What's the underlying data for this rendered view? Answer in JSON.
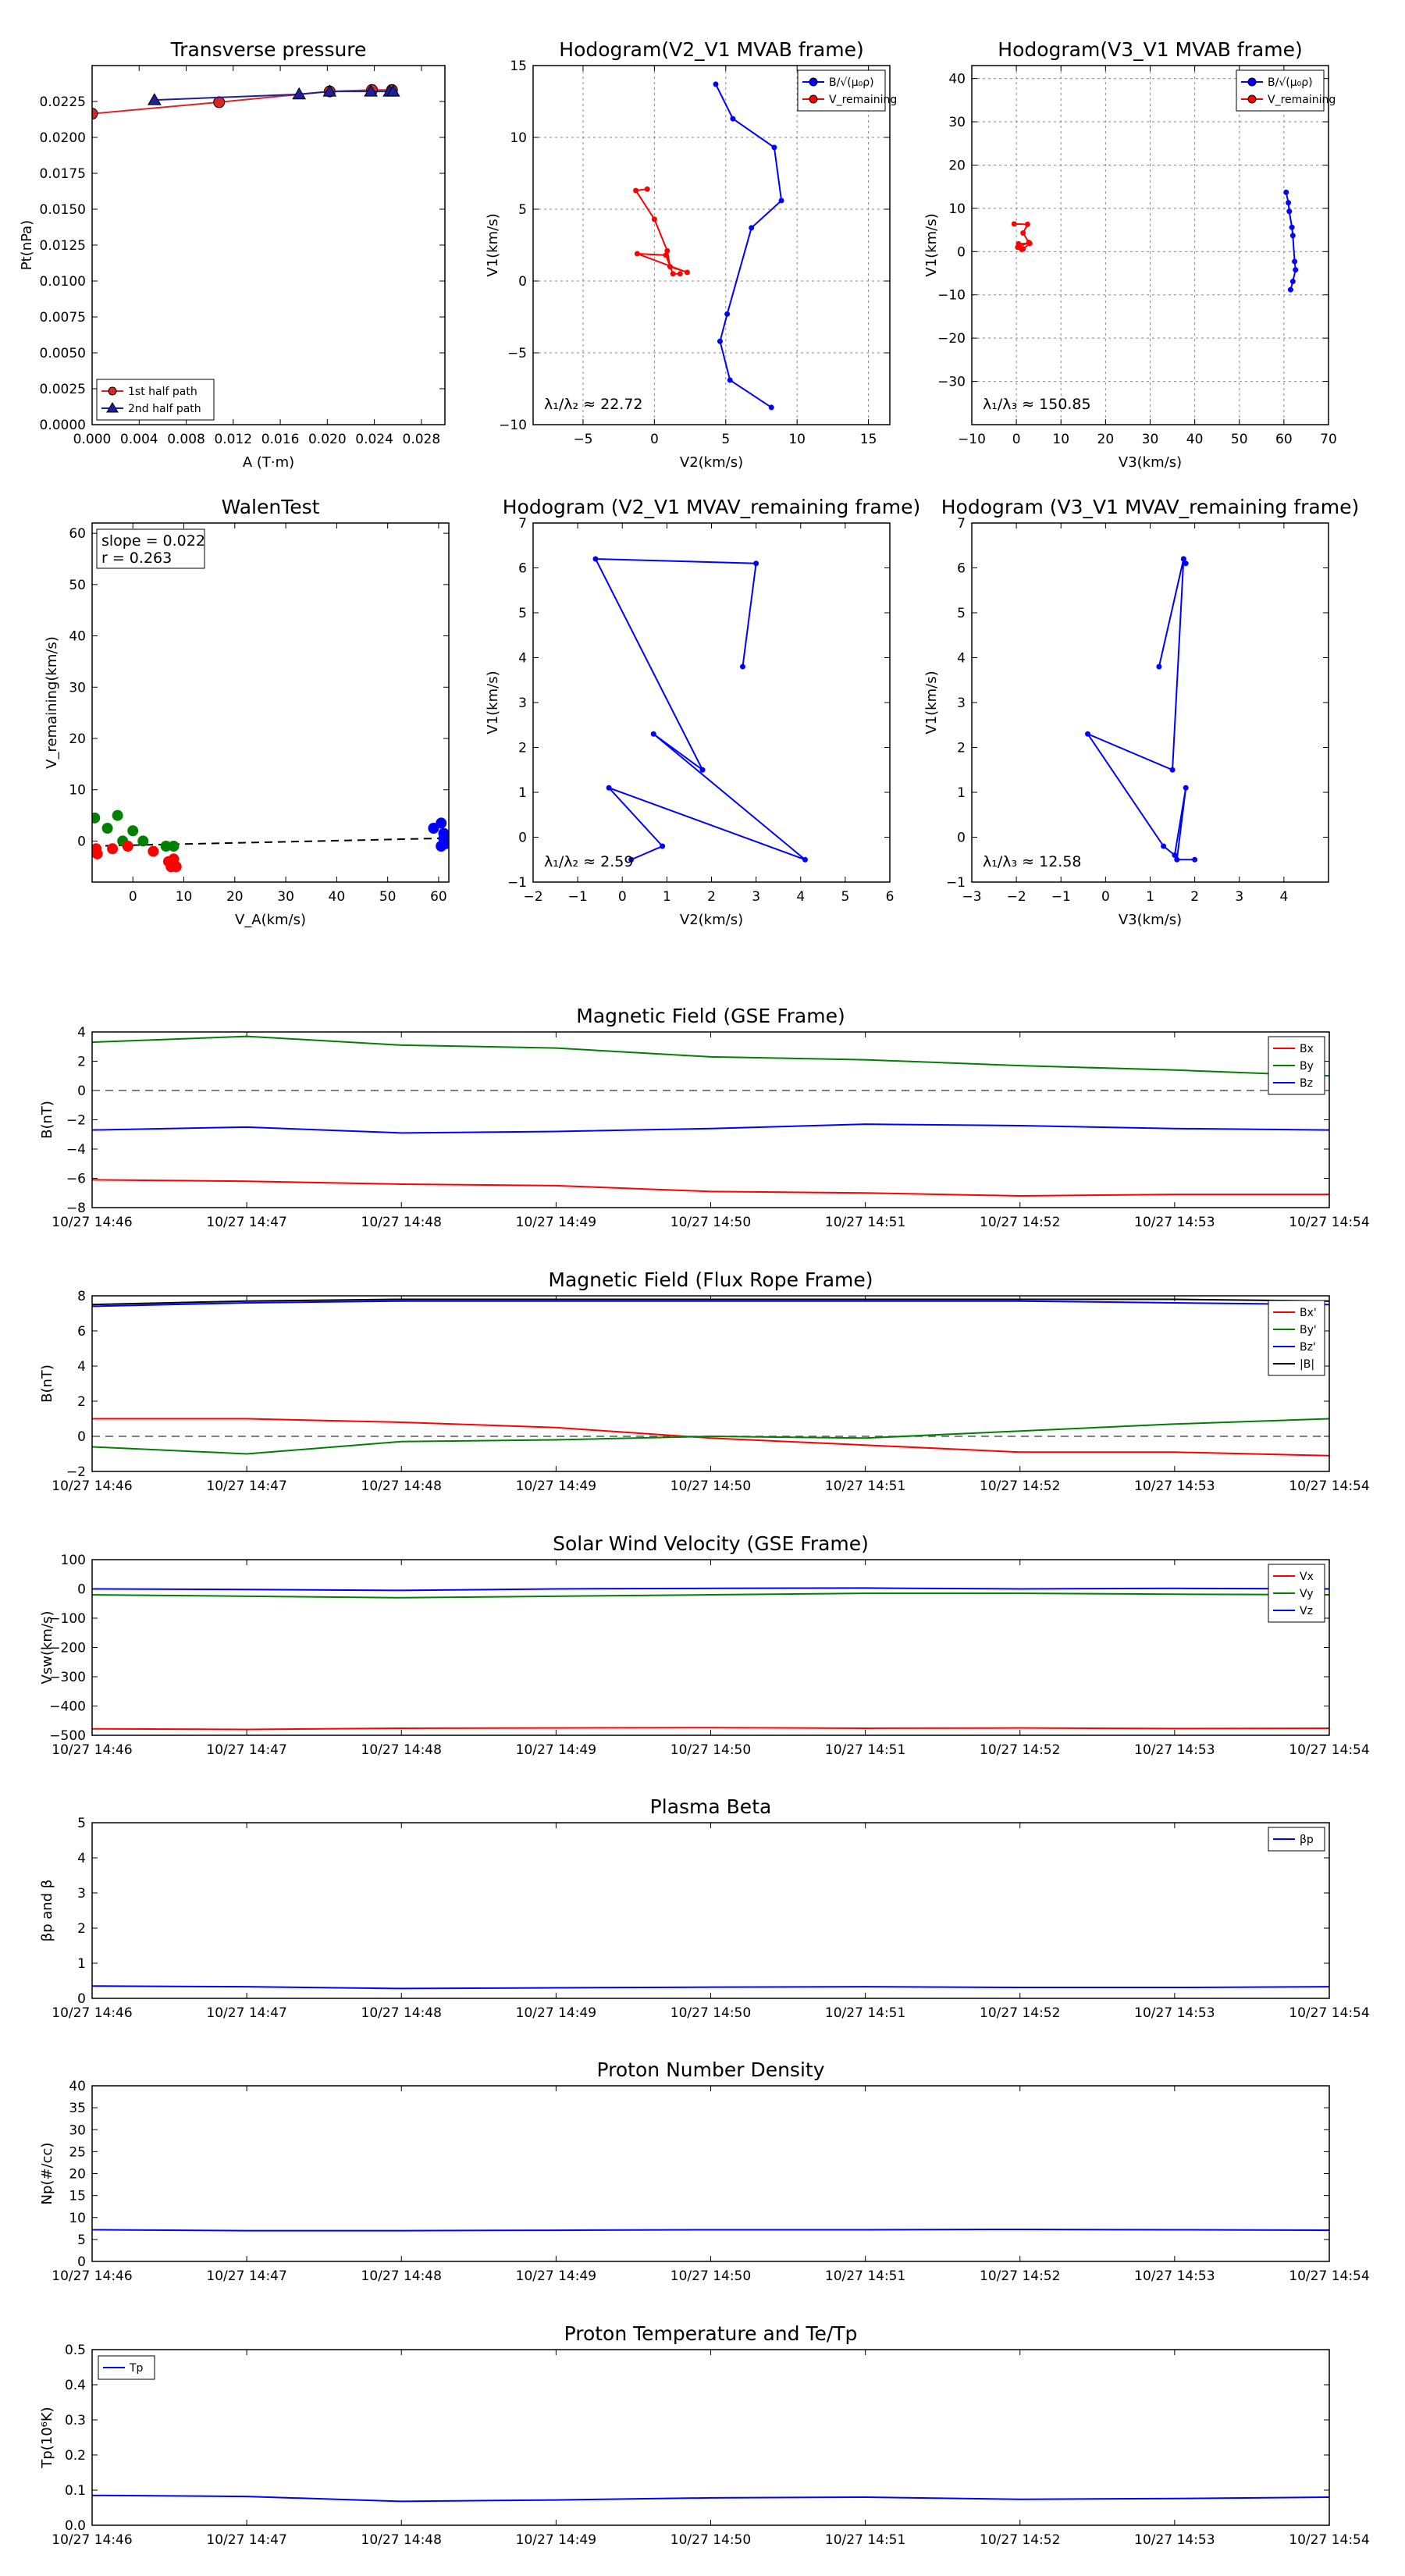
{
  "panels": [
    {
      "id": "transverse-pressure",
      "type": "scatter-line",
      "title": "Transverse pressure",
      "xlabel": "A (T·m)",
      "ylabel": "Pt(nPa)",
      "xlim": [
        0,
        0.03
      ],
      "ylim": [
        0,
        0.025
      ],
      "xticks": [
        0,
        0.004,
        0.008,
        0.012,
        0.016,
        0.02,
        0.024,
        0.028
      ],
      "xticklabels": [
        "0.000",
        "0.004",
        "0.008",
        "0.012",
        "0.016",
        "0.020",
        "0.024",
        "0.028"
      ],
      "yticks": [
        0,
        0.0025,
        0.005,
        0.0075,
        0.01,
        0.0125,
        0.015,
        0.0175,
        0.02,
        0.0225
      ],
      "yticklabels": [
        "0.0000",
        "0.0025",
        "0.0050",
        "0.0075",
        "0.0100",
        "0.0125",
        "0.0150",
        "0.0175",
        "0.0200",
        "0.0225"
      ],
      "grid": false,
      "legend": "lower-left",
      "series": [
        {
          "name": "1st half path",
          "color": "#d62728",
          "marker": "circle",
          "x": [
            0.0,
            0.0108,
            0.0202,
            0.0238,
            0.0255
          ],
          "y": [
            0.02165,
            0.02245,
            0.0232,
            0.0233,
            0.0233
          ]
        },
        {
          "name": "2nd half path",
          "color": "#1f1f9a",
          "marker": "triangle",
          "x": [
            0.0053,
            0.0176,
            0.0202,
            0.0237,
            0.0253,
            0.0256
          ],
          "y": [
            0.0226,
            0.023,
            0.0232,
            0.0232,
            0.0232,
            0.0232
          ]
        }
      ]
    },
    {
      "id": "hodogram-v2-v1-mvab",
      "type": "line",
      "title": "Hodogram(V2_V1 MVAB frame)",
      "xlabel": "V2(km/s)",
      "ylabel": "V1(km/s)",
      "xlim": [
        -8.5,
        16.5
      ],
      "ylim": [
        -10,
        15
      ],
      "xticks": [
        -5,
        0,
        5,
        10,
        15
      ],
      "xticklabels": [
        "−5",
        "0",
        "5",
        "10",
        "15"
      ],
      "yticks": [
        -10,
        -5,
        0,
        5,
        10,
        15
      ],
      "yticklabels": [
        "−10",
        "−5",
        "0",
        "5",
        "10",
        "15"
      ],
      "grid": true,
      "legend": "top-right",
      "note": "λ₁/λ₂ ≈ 22.72",
      "series": [
        {
          "name": "B/√(μ₀ρ)",
          "color": "#0000ff",
          "x": [
            4.3,
            5.5,
            8.4,
            8.9,
            6.8,
            5.1,
            4.6,
            5.3,
            8.2
          ],
          "y": [
            13.7,
            11.3,
            9.3,
            5.6,
            3.7,
            -2.3,
            -4.2,
            -6.9,
            -8.8
          ]
        },
        {
          "name": "V_remaining",
          "color": "#ff0000",
          "x": [
            -0.5,
            -1.3,
            0.0,
            0.9,
            1.1,
            2.3,
            -1.2,
            0.8,
            1.3,
            1.8
          ],
          "y": [
            6.4,
            6.3,
            4.3,
            2.1,
            1.0,
            0.6,
            1.9,
            1.8,
            0.5,
            0.5
          ]
        }
      ]
    },
    {
      "id": "hodogram-v3-v1-mvab",
      "type": "line",
      "title": "Hodogram(V3_V1 MVAB frame)",
      "xlabel": "V3(km/s)",
      "ylabel": "V1(km/s)",
      "xlim": [
        -10,
        70
      ],
      "ylim": [
        -40,
        43
      ],
      "xticks": [
        -10,
        0,
        10,
        20,
        30,
        40,
        50,
        60,
        70
      ],
      "xticklabels": [
        "−10",
        "0",
        "10",
        "20",
        "30",
        "40",
        "50",
        "60",
        "70"
      ],
      "yticks": [
        -30,
        -20,
        -10,
        0,
        10,
        20,
        30,
        40
      ],
      "yticklabels": [
        "−30",
        "−20",
        "−10",
        "0",
        "10",
        "20",
        "30",
        "40"
      ],
      "grid": true,
      "legend": "top-right",
      "note": "λ₁/λ₃ ≈ 150.85",
      "series": [
        {
          "name": "B/√(μ₀ρ)",
          "color": "#0000ff",
          "x": [
            60.5,
            61.0,
            61.2,
            61.8,
            62.0,
            62.4,
            62.6,
            62.0,
            61.5
          ],
          "y": [
            13.7,
            11.3,
            9.3,
            5.6,
            3.7,
            -2.3,
            -4.2,
            -6.9,
            -8.8
          ]
        },
        {
          "name": "V_remaining",
          "color": "#ff0000",
          "x": [
            -0.5,
            2.5,
            1.5,
            2.8,
            0.3,
            1.5,
            3.0,
            0.5,
            1.2
          ],
          "y": [
            6.4,
            6.3,
            4.3,
            2.1,
            1.0,
            0.6,
            1.9,
            1.8,
            0.5
          ]
        }
      ]
    },
    {
      "id": "walen-test",
      "type": "scatter",
      "title": "WalenTest",
      "xlabel": "V_A(km/s)",
      "ylabel": "V_remaining(km/s)",
      "xlim": [
        -8,
        62
      ],
      "ylim": [
        -8,
        62
      ],
      "xticks": [
        0,
        10,
        20,
        30,
        40,
        50,
        60
      ],
      "xticklabels": [
        "0",
        "10",
        "20",
        "30",
        "40",
        "50",
        "60"
      ],
      "yticks": [
        0,
        10,
        20,
        30,
        40,
        50,
        60
      ],
      "yticklabels": [
        "0",
        "10",
        "20",
        "30",
        "40",
        "50",
        "60"
      ],
      "grid": false,
      "stats": {
        "slope": "slope = 0.022",
        "r": "r = 0.263"
      },
      "fit": {
        "slope": 0.022,
        "intercept": -0.8
      },
      "series": [
        {
          "name": "blue",
          "color": "#0000ff",
          "x": [
            59,
            60.5,
            61,
            61.5,
            60.5,
            61
          ],
          "y": [
            2.5,
            3.5,
            1.5,
            -0.5,
            -1.0,
            0.5
          ]
        },
        {
          "name": "green",
          "color": "#008000",
          "x": [
            -7.5,
            -5,
            -3,
            -2,
            0,
            2,
            6.5,
            8
          ],
          "y": [
            4.5,
            2.5,
            5,
            0,
            2,
            0,
            -1,
            -1
          ]
        },
        {
          "name": "red",
          "color": "#ff0000",
          "x": [
            -7.2,
            -7,
            -4,
            -1,
            4,
            7,
            7.5,
            8,
            8.5
          ],
          "y": [
            -1.5,
            -2.5,
            -1.5,
            -1,
            -2,
            -4,
            -5,
            -3.5,
            -5
          ]
        }
      ]
    },
    {
      "id": "hodogram-v2-v1-mvav",
      "type": "line",
      "title": "Hodogram (V2_V1 MVAV_remaining frame)",
      "xlabel": "V2(km/s)",
      "ylabel": "V1(km/s)",
      "xlim": [
        -2,
        6
      ],
      "ylim": [
        -1,
        7
      ],
      "xticks": [
        -2,
        -1,
        0,
        1,
        2,
        3,
        4,
        5,
        6
      ],
      "xticklabels": [
        "−2",
        "−1",
        "0",
        "1",
        "2",
        "3",
        "4",
        "5",
        "6"
      ],
      "yticks": [
        -1,
        0,
        1,
        2,
        3,
        4,
        5,
        6,
        7
      ],
      "yticklabels": [
        "−1",
        "0",
        "1",
        "2",
        "3",
        "4",
        "5",
        "6",
        "7"
      ],
      "grid": false,
      "note": "λ₁/λ₂ ≈ 2.59",
      "series": [
        {
          "name": "path",
          "color": "#0000ff",
          "x": [
            2.7,
            3.0,
            -0.6,
            1.8,
            0.7,
            4.1,
            -0.3,
            0.9,
            0.2
          ],
          "y": [
            3.8,
            6.1,
            6.2,
            1.5,
            2.3,
            -0.5,
            1.1,
            -0.2,
            -0.5
          ]
        }
      ]
    },
    {
      "id": "hodogram-v3-v1-mvav",
      "type": "line",
      "title": "Hodogram (V3_V1 MVAV_remaining frame)",
      "xlabel": "V3(km/s)",
      "ylabel": "V1(km/s)",
      "xlim": [
        -3,
        5
      ],
      "ylim": [
        -1,
        7
      ],
      "xticks": [
        -3,
        -2,
        -1,
        0,
        1,
        2,
        3,
        4
      ],
      "xticklabels": [
        "−3",
        "−2",
        "−1",
        "0",
        "1",
        "2",
        "3",
        "4"
      ],
      "yticks": [
        -1,
        0,
        1,
        2,
        3,
        4,
        5,
        6,
        7
      ],
      "yticklabels": [
        "−1",
        "0",
        "1",
        "2",
        "3",
        "4",
        "5",
        "6",
        "7"
      ],
      "grid": false,
      "note": "λ₁/λ₃ ≈ 12.58",
      "series": [
        {
          "name": "path",
          "color": "#0000ff",
          "x": [
            1.2,
            1.75,
            1.8,
            1.75,
            1.5,
            -0.4,
            1.3,
            1.55,
            1.8,
            1.6,
            2.0
          ],
          "y": [
            3.8,
            6.2,
            6.1,
            6.2,
            1.5,
            2.3,
            -0.2,
            -0.4,
            1.1,
            -0.5,
            -0.5
          ]
        }
      ]
    },
    {
      "id": "magnetic-field-gse",
      "type": "timeseries",
      "title": "Magnetic Field (GSE Frame)",
      "ylabel": "B(nT)",
      "ylim": [
        -8,
        4
      ],
      "yticks": [
        -8,
        -6,
        -4,
        -2,
        0,
        2,
        4
      ],
      "yticklabels": [
        "−8",
        "−6",
        "−4",
        "−2",
        "0",
        "2",
        "4"
      ],
      "zero_line": true,
      "legend": "top-right",
      "series": [
        {
          "name": "Bx",
          "color": "#ff0000",
          "y": [
            -6.1,
            -6.2,
            -6.4,
            -6.5,
            -6.9,
            -7.0,
            -7.2,
            -7.1,
            -7.1
          ]
        },
        {
          "name": "By",
          "color": "#008000",
          "y": [
            3.3,
            3.7,
            3.1,
            2.9,
            2.3,
            2.1,
            1.7,
            1.4,
            1.0
          ]
        },
        {
          "name": "Bz",
          "color": "#0000ff",
          "y": [
            -2.7,
            -2.5,
            -2.9,
            -2.8,
            -2.6,
            -2.3,
            -2.4,
            -2.6,
            -2.7
          ]
        }
      ]
    },
    {
      "id": "magnetic-field-flux-rope",
      "type": "timeseries",
      "title": "Magnetic Field (Flux Rope Frame)",
      "ylabel": "B(nT)",
      "ylim": [
        -2,
        8
      ],
      "yticks": [
        -2,
        0,
        2,
        4,
        6,
        8
      ],
      "yticklabels": [
        "−2",
        "0",
        "2",
        "4",
        "6",
        "8"
      ],
      "zero_line": true,
      "legend": "top-right",
      "series": [
        {
          "name": "Bx'",
          "color": "#ff0000",
          "y": [
            1.0,
            1.0,
            0.8,
            0.5,
            -0.1,
            -0.5,
            -0.9,
            -0.9,
            -1.1
          ]
        },
        {
          "name": "By'",
          "color": "#008000",
          "y": [
            -0.6,
            -1.0,
            -0.3,
            -0.2,
            0.0,
            -0.1,
            0.3,
            0.7,
            1.0
          ]
        },
        {
          "name": "Bz'",
          "color": "#0000ff",
          "y": [
            7.4,
            7.6,
            7.7,
            7.7,
            7.7,
            7.7,
            7.7,
            7.6,
            7.5
          ]
        },
        {
          "name": "|B|",
          "color": "#000000",
          "y": [
            7.5,
            7.7,
            7.8,
            7.8,
            7.8,
            7.8,
            7.8,
            7.8,
            7.7
          ]
        }
      ]
    },
    {
      "id": "solar-wind-velocity",
      "type": "timeseries",
      "title": "Solar Wind Velocity (GSE Frame)",
      "ylabel": "Vsw(km/s)",
      "ylim": [
        -500,
        100
      ],
      "yticks": [
        -500,
        -400,
        -300,
        -200,
        -100,
        0,
        100
      ],
      "yticklabels": [
        "−500",
        "−400",
        "−300",
        "−200",
        "−100",
        "0",
        "100"
      ],
      "zero_line": false,
      "legend": "top-right",
      "series": [
        {
          "name": "Vx",
          "color": "#ff0000",
          "y": [
            -478,
            -480,
            -476,
            -475,
            -474,
            -476,
            -475,
            -477,
            -476
          ]
        },
        {
          "name": "Vy",
          "color": "#008000",
          "y": [
            -20,
            -25,
            -30,
            -25,
            -20,
            -15,
            -15,
            -18,
            -20
          ]
        },
        {
          "name": "Vz",
          "color": "#0000ff",
          "y": [
            0,
            -2,
            -5,
            0,
            2,
            3,
            0,
            2,
            0
          ]
        }
      ]
    },
    {
      "id": "plasma-beta",
      "type": "timeseries",
      "title": "Plasma Beta",
      "ylabel": "βp and β",
      "ylim": [
        0,
        5
      ],
      "yticks": [
        0,
        1,
        2,
        3,
        4,
        5
      ],
      "yticklabels": [
        "0",
        "1",
        "2",
        "3",
        "4",
        "5"
      ],
      "zero_line": false,
      "legend": "top-right",
      "series": [
        {
          "name": "βp",
          "color": "#0000ff",
          "y": [
            0.35,
            0.33,
            0.28,
            0.3,
            0.32,
            0.33,
            0.31,
            0.31,
            0.33
          ]
        }
      ]
    },
    {
      "id": "proton-number-density",
      "type": "timeseries",
      "title": "Proton Number Density",
      "ylabel": "Np(#/cc)",
      "ylim": [
        0,
        40
      ],
      "yticks": [
        0,
        5,
        10,
        15,
        20,
        25,
        30,
        35,
        40
      ],
      "yticklabels": [
        "0",
        "5",
        "10",
        "15",
        "20",
        "25",
        "30",
        "35",
        "40"
      ],
      "zero_line": false,
      "series": [
        {
          "name": "Np",
          "color": "#0000ff",
          "y": [
            7.2,
            7.0,
            7.0,
            7.1,
            7.2,
            7.2,
            7.3,
            7.2,
            7.1
          ]
        }
      ]
    },
    {
      "id": "proton-temperature",
      "type": "timeseries",
      "title": "Proton Temperature and Te/Tp",
      "ylabel": "Tp(10⁶K)",
      "ylim": [
        0,
        0.5
      ],
      "yticks": [
        0,
        0.1,
        0.2,
        0.3,
        0.4,
        0.5
      ],
      "yticklabels": [
        "0.0",
        "0.1",
        "0.2",
        "0.3",
        "0.4",
        "0.5"
      ],
      "zero_line": false,
      "legend": "top-left",
      "series": [
        {
          "name": "Tp",
          "color": "#0000ff",
          "y": [
            0.085,
            0.082,
            0.068,
            0.072,
            0.078,
            0.08,
            0.074,
            0.076,
            0.08
          ]
        }
      ]
    }
  ],
  "time_axis": {
    "ticklabels": [
      "10/27 14:46",
      "10/27 14:47",
      "10/27 14:48",
      "10/27 14:49",
      "10/27 14:50",
      "10/27 14:51",
      "10/27 14:52",
      "10/27 14:53",
      "10/27 14:54"
    ]
  }
}
